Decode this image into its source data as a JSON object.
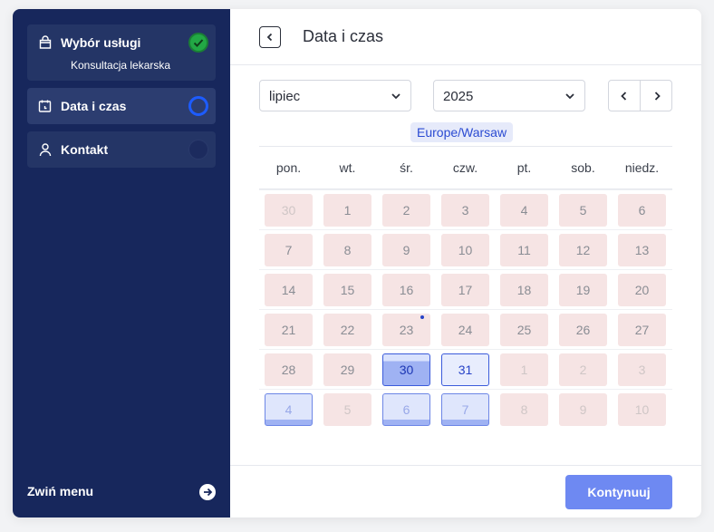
{
  "sidebar": {
    "steps": [
      {
        "label": "Wybór usługi",
        "sub": "Konsultacja lekarska",
        "icon": "shopping-bag-icon",
        "status": "done"
      },
      {
        "label": "Data i czas",
        "icon": "calendar-clock-icon",
        "status": "current"
      },
      {
        "label": "Kontakt",
        "icon": "user-icon",
        "status": "pending"
      }
    ],
    "collapse_label": "Zwiń menu"
  },
  "main": {
    "title": "Data i czas",
    "month": "lipiec",
    "year": "2025",
    "timezone": "Europe/Warsaw",
    "weekdays": [
      "pon.",
      "wt.",
      "śr.",
      "czw.",
      "pt.",
      "sob.",
      "niedz."
    ],
    "weeks": [
      [
        "30",
        "1",
        "2",
        "3",
        "4",
        "5",
        "6"
      ],
      [
        "7",
        "8",
        "9",
        "10",
        "11",
        "12",
        "13"
      ],
      [
        "14",
        "15",
        "16",
        "17",
        "18",
        "19",
        "20"
      ],
      [
        "21",
        "22",
        "23",
        "24",
        "25",
        "26",
        "27"
      ],
      [
        "28",
        "29",
        "30",
        "31",
        "1",
        "2",
        "3"
      ],
      [
        "4",
        "5",
        "6",
        "7",
        "8",
        "9",
        "10"
      ]
    ],
    "continue_label": "Kontynuuj"
  },
  "colors": {
    "sidebar_bg": "#17275c",
    "accent": "#3b5bdb",
    "done": "#22a845",
    "button": "#6e89f2"
  }
}
